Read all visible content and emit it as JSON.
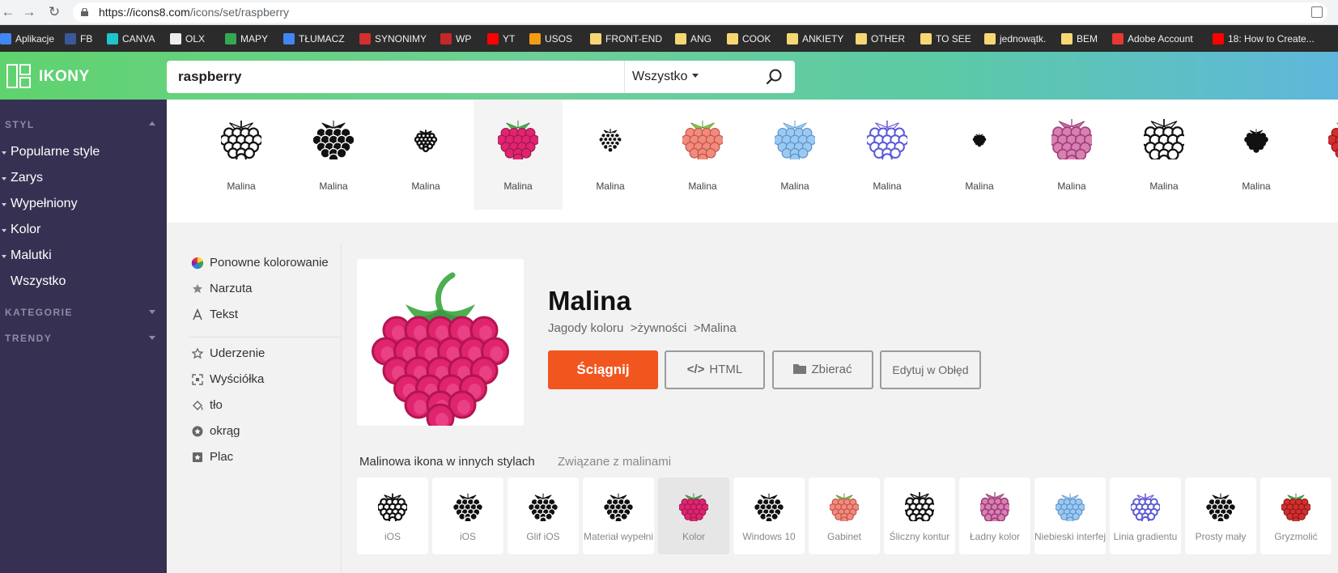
{
  "browser": {
    "url_host": "https://icons8.com",
    "url_path": "/icons/set/raspberry",
    "bookmarks": [
      {
        "label": "Aplikacje",
        "icon": "apps-grid-icon",
        "color": "#4285f4"
      },
      {
        "label": "FB",
        "icon": "facebook-icon",
        "color": "#3b5998"
      },
      {
        "label": "CANVA",
        "icon": "canva-icon",
        "color": "#20c4cb"
      },
      {
        "label": "OLX",
        "icon": "olx-icon",
        "color": "#eeeeee"
      },
      {
        "label": "MAPY",
        "icon": "maps-icon",
        "color": "#34a853"
      },
      {
        "label": "TŁUMACZ",
        "icon": "translate-icon",
        "color": "#4285f4"
      },
      {
        "label": "SYNONIMY",
        "icon": "synonyms-icon",
        "color": "#d32f2f"
      },
      {
        "label": "WP",
        "icon": "wp-icon",
        "color": "#c62828"
      },
      {
        "label": "YT",
        "icon": "youtube-icon",
        "color": "#ff0000"
      },
      {
        "label": "USOS",
        "icon": "usos-icon",
        "color": "#f39c12"
      },
      {
        "label": "FRONT-END",
        "icon": "folder-icon",
        "color": "#f7d774"
      },
      {
        "label": "ANG",
        "icon": "folder-icon",
        "color": "#f7d774"
      },
      {
        "label": "COOK",
        "icon": "folder-icon",
        "color": "#f7d774"
      },
      {
        "label": "ANKIETY",
        "icon": "folder-icon",
        "color": "#f7d774"
      },
      {
        "label": "OTHER",
        "icon": "folder-icon",
        "color": "#f7d774"
      },
      {
        "label": "TO SEE",
        "icon": "folder-icon",
        "color": "#f7d774"
      },
      {
        "label": "jednowątk.",
        "icon": "folder-icon",
        "color": "#f7d774"
      },
      {
        "label": "BEM",
        "icon": "folder-icon",
        "color": "#f7d774"
      },
      {
        "label": "Adobe Account",
        "icon": "adobe-icon",
        "color": "#e53935"
      },
      {
        "label": "18: How to Create...",
        "icon": "youtube-icon",
        "color": "#ff0000"
      }
    ]
  },
  "header": {
    "logo": "IKONY",
    "search_value": "raspberry",
    "search_category": "Wszystko"
  },
  "sidebar": {
    "section_style": "STYL",
    "items": [
      "Popularne style",
      "Zarys",
      "Wypełniony",
      "Kolor",
      "Malutki",
      "Wszystko"
    ],
    "section_categories": "KATEGORIE",
    "section_trends": "TRENDY"
  },
  "strip": {
    "items": [
      {
        "label": "Malina",
        "style": "outline"
      },
      {
        "label": "Malina",
        "style": "filled"
      },
      {
        "label": "Malina",
        "style": "tiny"
      },
      {
        "label": "Malina",
        "style": "color"
      },
      {
        "label": "Malina",
        "style": "tiny-filled"
      },
      {
        "label": "Malina",
        "style": "salmon"
      },
      {
        "label": "Malina",
        "style": "blue"
      },
      {
        "label": "Malina",
        "style": "gradient-line"
      },
      {
        "label": "Malina",
        "style": "micro"
      },
      {
        "label": "Malina",
        "style": "pink-sketch"
      },
      {
        "label": "Malina",
        "style": "outline-sketch"
      },
      {
        "label": "Malina",
        "style": "simple"
      },
      {
        "label": "M",
        "style": "red"
      }
    ]
  },
  "options": {
    "group1": [
      {
        "label": "Ponowne kolorowanie",
        "icon": "recolor-icon"
      },
      {
        "label": "Narzuta",
        "icon": "overlay-icon"
      },
      {
        "label": "Tekst",
        "icon": "text-icon"
      }
    ],
    "group2": [
      {
        "label": "Uderzenie",
        "icon": "stroke-icon"
      },
      {
        "label": "Wyściółka",
        "icon": "padding-icon"
      },
      {
        "label": "tło",
        "icon": "background-fill-icon"
      },
      {
        "label": "okrąg",
        "icon": "circle-icon"
      },
      {
        "label": "Plac",
        "icon": "square-icon"
      }
    ]
  },
  "detail": {
    "title": "Malina",
    "crumb1": "Jagody koloru",
    "crumb2": "żywności",
    "crumb3": "Malina",
    "download": "Ściągnij",
    "html": "HTML",
    "collect": "Zbierać",
    "edit": "Edytuj w Obłęd"
  },
  "tabs": {
    "active": "Malinowa ikona w innych stylach",
    "other": "Związane z malinami"
  },
  "styles": [
    {
      "label": "iOS"
    },
    {
      "label": "iOS"
    },
    {
      "label": "Glif iOS"
    },
    {
      "label": "Materiał wypełni"
    },
    {
      "label": "Kolor"
    },
    {
      "label": "Windows 10"
    },
    {
      "label": "Gabinet"
    },
    {
      "label": "Śliczny kontur"
    },
    {
      "label": "Ładny kolor"
    },
    {
      "label": "Niebieski interfej"
    },
    {
      "label": "Linia gradientu"
    },
    {
      "label": "Prosty mały"
    },
    {
      "label": "Gryzmolić"
    }
  ],
  "colors": {
    "accent": "#f1561f",
    "sidebar": "#363152",
    "raspberry": "#e0246f",
    "leaf": "#4caf50"
  }
}
